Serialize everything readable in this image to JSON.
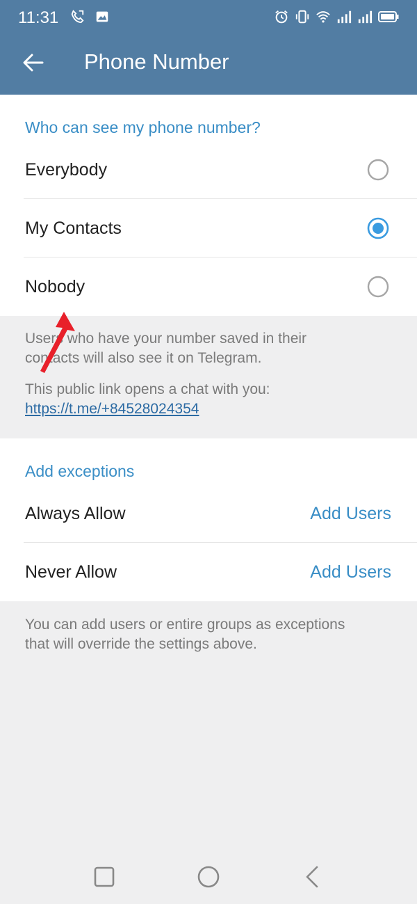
{
  "status_bar": {
    "time": "11:31",
    "left_icons": [
      "call-forward-icon",
      "image-icon"
    ],
    "right_icons": [
      "alarm-icon",
      "vibrate-icon",
      "wifi-icon",
      "signal-icon",
      "signal-icon",
      "battery-icon"
    ]
  },
  "header": {
    "title": "Phone Number",
    "back_icon": "back-arrow-icon"
  },
  "visibility": {
    "header": "Who can see my phone number?",
    "options": [
      {
        "label": "Everybody",
        "selected": false
      },
      {
        "label": "My Contacts",
        "selected": true
      },
      {
        "label": "Nobody",
        "selected": false
      }
    ],
    "info_line1": "Users who have your number saved in their",
    "info_line2": "contacts will also see it on Telegram.",
    "link_intro": "This public link opens a chat with you:",
    "link": "https://t.me/+84528024354"
  },
  "exceptions": {
    "header": "Add exceptions",
    "rows": [
      {
        "label": "Always Allow",
        "action": "Add Users"
      },
      {
        "label": "Never Allow",
        "action": "Add Users"
      }
    ],
    "info_line1": "You can add users or entire groups as exceptions",
    "info_line2": "that will override the settings above."
  },
  "colors": {
    "header_bg": "#527da3",
    "accent": "#3a8ec6",
    "annotation_arrow": "#e8202a"
  }
}
